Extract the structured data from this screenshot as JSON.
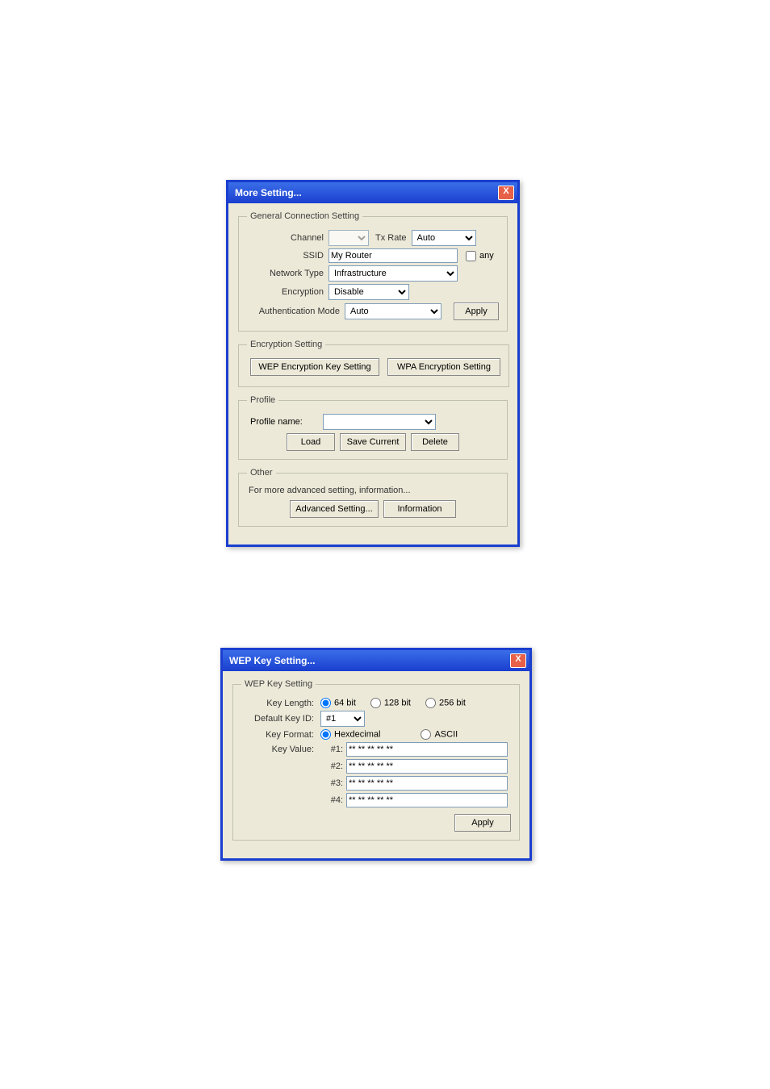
{
  "window1": {
    "title": "More Setting...",
    "close": "X",
    "general": {
      "legend": "General Connection Setting",
      "channel_label": "Channel",
      "channel_value": "",
      "txrate_label": "Tx Rate",
      "txrate_value": "Auto",
      "ssid_label": "SSID",
      "ssid_value": "My Router",
      "any_label": "any",
      "nettype_label": "Network Type",
      "nettype_value": "Infrastructure",
      "encryption_label": "Encryption",
      "encryption_value": "Disable",
      "auth_label": "Authentication Mode",
      "auth_value": "Auto",
      "apply": "Apply"
    },
    "encset": {
      "legend": "Encryption Setting",
      "wep_btn": "WEP Encryption Key Setting",
      "wpa_btn": "WPA Encryption Setting"
    },
    "profile": {
      "legend": "Profile",
      "name_label": "Profile name:",
      "value": "",
      "load": "Load",
      "save": "Save Current",
      "delete": "Delete"
    },
    "other": {
      "legend": "Other",
      "note": "For more advanced setting, information...",
      "advanced": "Advanced Setting...",
      "info": "Information"
    }
  },
  "window2": {
    "title": "WEP Key Setting...",
    "close": "X",
    "wep": {
      "legend": "WEP Key Setting",
      "keylen_label": "Key Length:",
      "opt64": "64 bit",
      "opt128": "128 bit",
      "opt256": "256 bit",
      "defid_label": "Default Key ID:",
      "defid_value": "#1",
      "format_label": "Key Format:",
      "opthex": "Hexdecimal",
      "optasc": "ASCII",
      "keyval_label": "Key Value:",
      "k1l": "#1:",
      "k2l": "#2:",
      "k3l": "#3:",
      "k4l": "#4:",
      "k1": "** ** ** ** **",
      "k2": "** ** ** ** **",
      "k3": "** ** ** ** **",
      "k4": "** ** ** ** **",
      "apply": "Apply"
    }
  }
}
